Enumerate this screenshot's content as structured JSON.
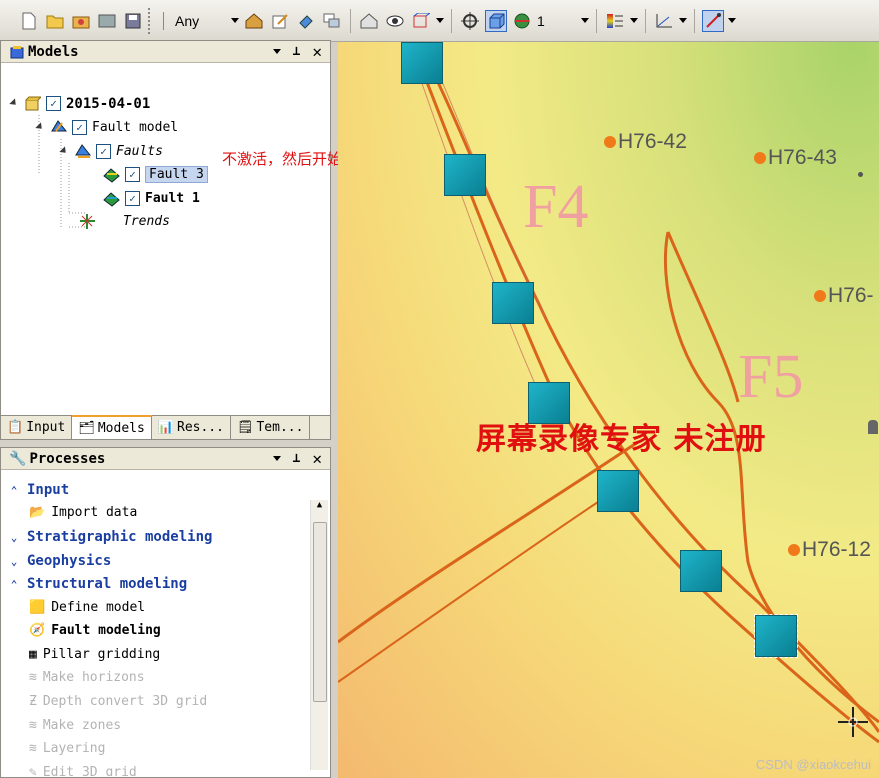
{
  "toolbar": {
    "selection_dropdown": "Any",
    "index_dropdown": "1"
  },
  "models_panel": {
    "title": "Models",
    "tree": {
      "root": "2015-04-01",
      "fault_model": "Fault model",
      "faults": "Faults",
      "fault3": "Fault 3",
      "fault1": "Fault 1",
      "trends": "Trends"
    },
    "tabs": [
      "Input",
      "Models",
      "Res...",
      "Tem..."
    ]
  },
  "annotation": "不激活，然后开始新断层",
  "processes_panel": {
    "title": "Processes",
    "items": [
      {
        "label": "Input",
        "type": "group"
      },
      {
        "label": "Import data",
        "type": "item"
      },
      {
        "label": "Stratigraphic modeling",
        "type": "group"
      },
      {
        "label": "Geophysics",
        "type": "group"
      },
      {
        "label": "Structural modeling",
        "type": "group"
      },
      {
        "label": "Define model",
        "type": "item"
      },
      {
        "label": "Fault modeling",
        "type": "item-active"
      },
      {
        "label": "Pillar gridding",
        "type": "item"
      },
      {
        "label": "Make horizons",
        "type": "disabled"
      },
      {
        "label": "Depth convert 3D grid",
        "type": "disabled"
      },
      {
        "label": "Make zones",
        "type": "disabled"
      },
      {
        "label": "Layering",
        "type": "disabled"
      },
      {
        "label": "Edit 3D grid",
        "type": "disabled"
      }
    ]
  },
  "map": {
    "fault_labels": [
      "F4",
      "F5"
    ],
    "wells": [
      "H76-42",
      "H76-43",
      "H76-",
      "H76-12"
    ],
    "watermark": "屏幕录像专家 未注册",
    "credit": "CSDN @xiaokcehui"
  }
}
